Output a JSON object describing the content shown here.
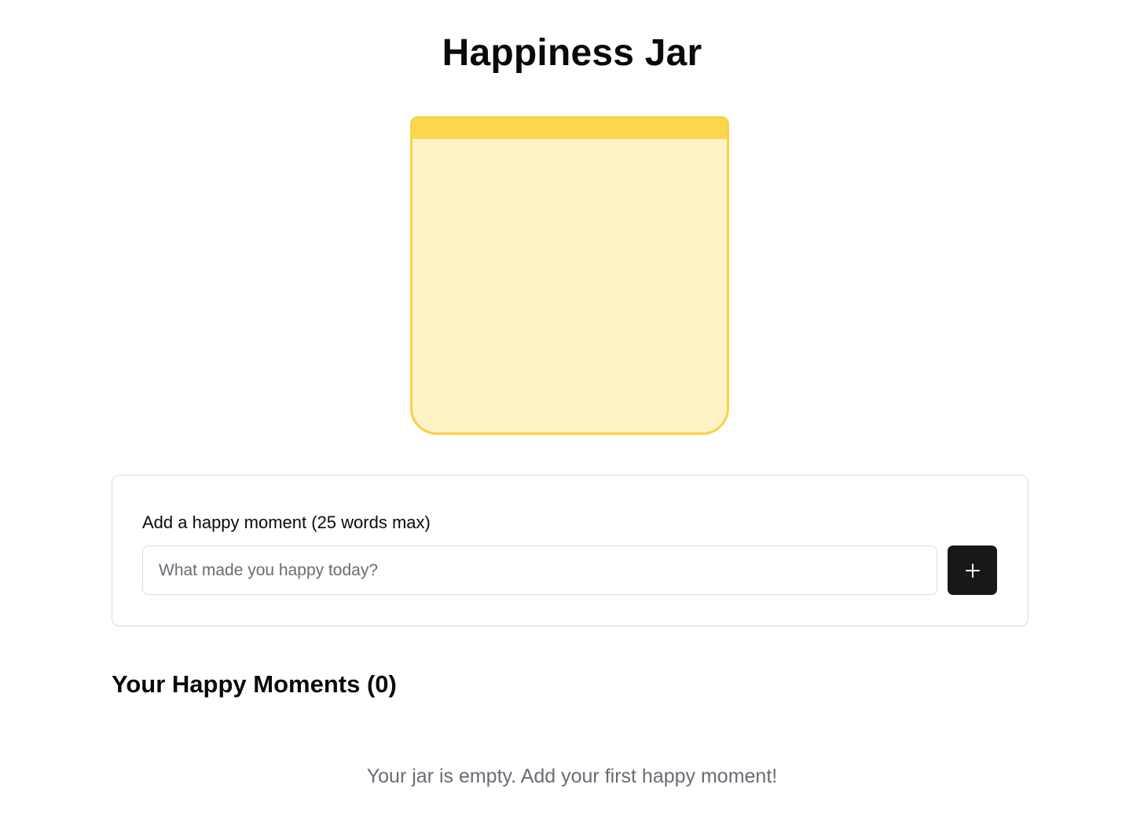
{
  "app": {
    "title": "Happiness Jar"
  },
  "jar": {
    "moment_count": 0,
    "colors": {
      "lid": "#fdd64d",
      "body": "#fdf3c6",
      "border": "#f7d244"
    }
  },
  "form": {
    "label": "Add a happy moment (25 words max)",
    "input_value": "",
    "input_placeholder": "What made you happy today?",
    "add_button_icon": "plus-icon"
  },
  "moments": {
    "heading": "Your Happy Moments (0)",
    "items": [],
    "empty_message": "Your jar is empty. Add your first happy moment!"
  }
}
